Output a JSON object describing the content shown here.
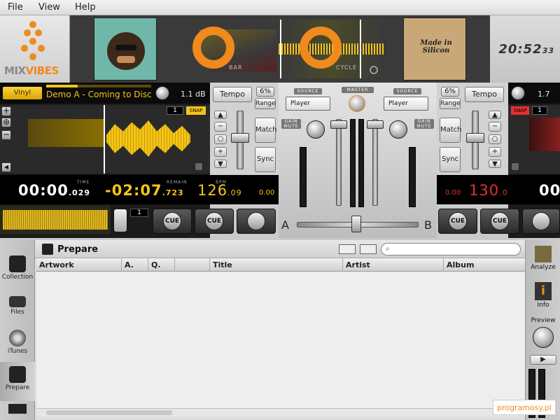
{
  "menu": [
    "File",
    "View",
    "Help"
  ],
  "brand": {
    "text_a": "MIX",
    "text_b": "VIBES"
  },
  "clock": {
    "main": "20:52",
    "seconds": "33"
  },
  "header": {
    "bar_label": "BAR",
    "cycle_label": "CYCLE",
    "art_right_text": "Made in Silicon"
  },
  "deck_a": {
    "vinyl_label": "Vinyl",
    "track_title": "Demo A - Coming to Disco",
    "gain": "1.1 dB",
    "beat_num": "1",
    "snap": "SNAP",
    "time_label": "TIME",
    "time_main": "00:00",
    "time_ms": ".029",
    "remain_label": "REMAIN",
    "remain_main": "-02:07",
    "remain_ms": ".723",
    "bpm_label": "BPM",
    "bpm_main": "126",
    "bpm_dec": ".09",
    "pitch_zero": "0.00",
    "loop_num": "1",
    "tempo_label": "Tempo",
    "range_pct": "6%",
    "range_label": "Range",
    "match_label": "Match",
    "sync_label": "Sync",
    "cue1": "CUE",
    "cue2": "CUE"
  },
  "deck_b": {
    "gain": "1.7",
    "snap": "SNAP",
    "beat_num": "1",
    "pitch_zero": "0.00",
    "bpm_main": "130",
    "bpm_dec": ".00",
    "time_partial": "00",
    "tempo_label": "Tempo",
    "range_pct": "6%",
    "range_label": "Range",
    "match_label": "Match",
    "sync_label": "Sync",
    "cue1": "CUE",
    "cue2": "CUE"
  },
  "mixer": {
    "source_label": "SOURCE",
    "master_label": "MASTER",
    "player_left": "Player",
    "player_right": "Player",
    "gain_mute": "GAIN MUTE",
    "crossfader_a": "A",
    "crossfader_b": "B"
  },
  "browser": {
    "title": "Prepare",
    "search_placeholder": "",
    "columns": [
      "Artwork",
      "A.",
      "Q.",
      "",
      "Title",
      "Artist",
      "Album"
    ],
    "left_nav": [
      "Collection",
      "Files",
      "iTunes",
      "Prepare"
    ],
    "right_nav": [
      "Analyze",
      "Info",
      "Preview"
    ]
  },
  "watermark": "programosy.pl",
  "colors": {
    "accent": "#f08a1c",
    "deck_yellow": "#f5c518",
    "deck_red": "#e33030"
  }
}
